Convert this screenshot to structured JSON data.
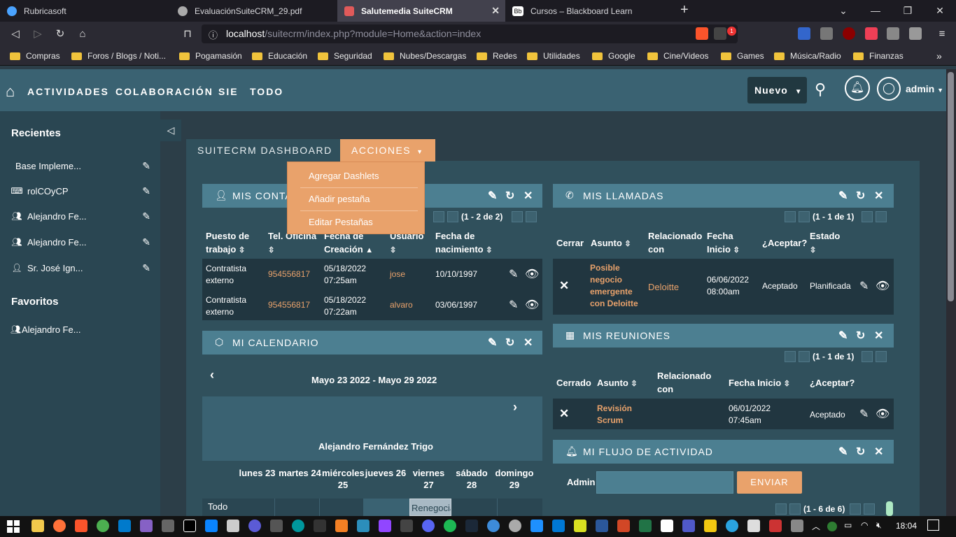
{
  "browser": {
    "tabs": [
      "Rubricasoft",
      "EvaluaciónSuiteCRM_29.pdf",
      "Salutemedia SuiteCRM",
      "Cursos – Blackboard Learn"
    ],
    "url_host": "localhost",
    "url_path": "/suitecrm/index.php?module=Home&action=index",
    "shield_badge": "1",
    "bookmarks": [
      "Compras",
      "Foros / Blogs / Noti...",
      "Pogamasión",
      "Educación",
      "Seguridad",
      "Nubes/Descargas",
      "Redes",
      "Utilidades",
      "Google",
      "Cine/Videos",
      "Games",
      "Música/Radio",
      "Finanzas"
    ],
    "more_bookmarks": "»"
  },
  "topnav": {
    "items": [
      "ACTIVIDADES",
      "COLABORACIÓN",
      "SIE",
      "TODO"
    ],
    "new_button": "Nuevo",
    "user": "admin"
  },
  "sidebar": {
    "recent_title": "Recientes",
    "recent_items": [
      "Base Impleme...",
      "rolCOyCP",
      "Alejandro Fe...",
      "Alejandro Fe...",
      "Sr. José Ign..."
    ],
    "fav_title": "Favoritos",
    "fav_items": [
      "Alejandro Fe..."
    ]
  },
  "page_tabs": {
    "dashboard": "SUITECRM DASHBOARD",
    "actions": "ACCIONES",
    "menu": [
      "Agregar Dashlets",
      "Añadir pestaña",
      "Editar Pestañas"
    ]
  },
  "contacts": {
    "title": "MIS CONTA",
    "pager": "(1 - 2 de 2)",
    "headers": [
      "Puesto de trabajo",
      "Tel. Oficina",
      "Fecha de Creación",
      "Usuario",
      "Fecha de nacimiento"
    ],
    "rows": [
      [
        "Contratista externo",
        "954556817",
        "05/18/2022 07:25am",
        "jose",
        "10/10/1997"
      ],
      [
        "Contratista externo",
        "954556817",
        "05/18/2022 07:22am",
        "alvaro",
        "03/06/1997"
      ]
    ]
  },
  "calendar": {
    "title": "MI CALENDARIO",
    "range": "Mayo 23 2022 - Mayo 29 2022",
    "person": "Alejandro Fernández Trigo",
    "days": [
      "lunes 23",
      "martes 24",
      "miércoles 25",
      "jueves 26",
      "viernes 27",
      "sábado 28",
      "domingo 29"
    ],
    "all_day": "Todo",
    "event": "Renegocia"
  },
  "calls": {
    "title": "MIS LLAMADAS",
    "pager": "(1 - 1 de 1)",
    "headers": [
      "Cerrar",
      "Asunto",
      "Relacionado con",
      "Fecha Inicio",
      "¿Aceptar?",
      "Estado"
    ],
    "row": {
      "subject": "Posible negocio emergente con Deloitte",
      "related": "Deloitte",
      "date": "06/06/2022 08:00am",
      "accept": "Aceptado",
      "status": "Planificada"
    }
  },
  "meetings": {
    "title": "MIS REUNIONES",
    "pager": "(1 - 1 de 1)",
    "headers": [
      "Cerrado",
      "Asunto",
      "Relacionado con",
      "Fecha Inicio",
      "¿Aceptar?"
    ],
    "row": {
      "subject": "Revisión Scrum",
      "date": "06/01/2022 07:45am",
      "accept": "Aceptado"
    }
  },
  "activity": {
    "title": "MI FLUJO DE ACTIVIDAD",
    "label": "Admin",
    "send": "ENVIAR",
    "pager": "(1 - 6 de 6)"
  },
  "taskbar": {
    "time": "18:04"
  }
}
